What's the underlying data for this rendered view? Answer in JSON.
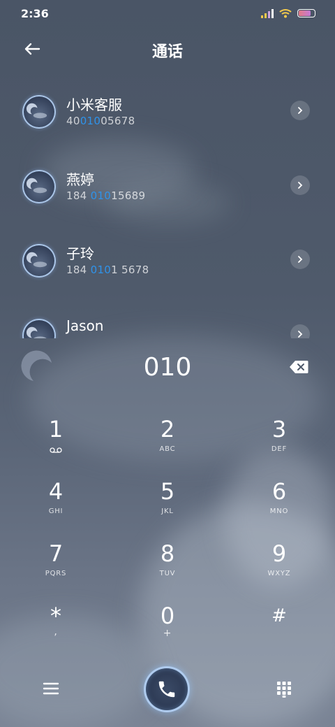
{
  "status_bar": {
    "time": "2:36",
    "battery_fill": 0.75
  },
  "header": {
    "title": "通话"
  },
  "contacts": [
    {
      "name": "小米客服",
      "number_parts": [
        "40",
        "010",
        "05678"
      ]
    },
    {
      "name": "燕婷",
      "number_parts": [
        "184 ",
        "010",
        "15689"
      ]
    },
    {
      "name": "子玲",
      "number_parts": [
        "184 ",
        "010",
        "1 5678"
      ]
    },
    {
      "name": "Jason",
      "number_parts": [
        "",
        "",
        ""
      ]
    }
  ],
  "dial": {
    "entered_number": "010"
  },
  "keypad": [
    {
      "digit": "1",
      "letters": ""
    },
    {
      "digit": "2",
      "letters": "ABC"
    },
    {
      "digit": "3",
      "letters": "DEF"
    },
    {
      "digit": "4",
      "letters": "GHI"
    },
    {
      "digit": "5",
      "letters": "JKL"
    },
    {
      "digit": "6",
      "letters": "MNO"
    },
    {
      "digit": "7",
      "letters": "PQRS"
    },
    {
      "digit": "8",
      "letters": "TUV"
    },
    {
      "digit": "9",
      "letters": "WXYZ"
    },
    {
      "digit": "*",
      "letters": ","
    },
    {
      "digit": "0",
      "letters": "+"
    },
    {
      "digit": "#",
      "letters": ""
    }
  ],
  "colors": {
    "highlight": "#2f93ea",
    "background": "#4f5a6b"
  },
  "icons": [
    "back-arrow-icon",
    "chevron-right-icon",
    "backspace-icon",
    "voicemail-icon",
    "menu-icon",
    "phone-icon",
    "dialpad-icon",
    "moon-icon",
    "wifi-icon",
    "signal-icon",
    "battery-icon"
  ]
}
